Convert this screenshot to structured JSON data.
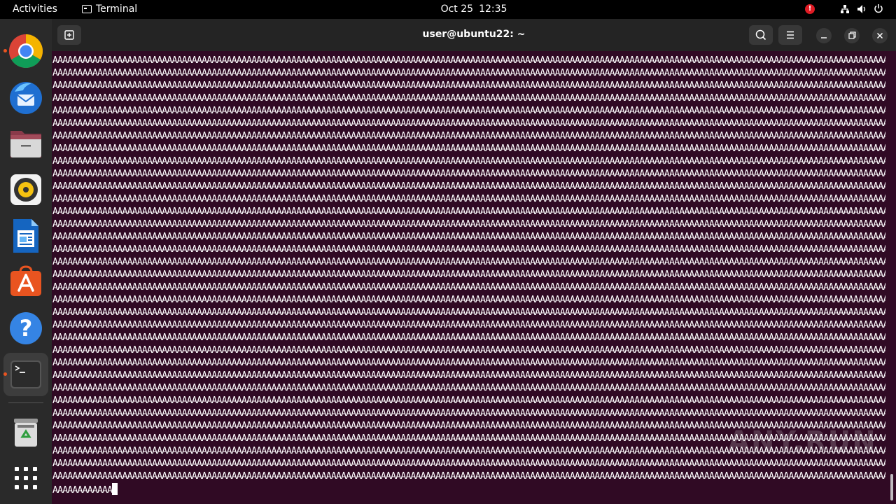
{
  "topbar": {
    "activities": "Activities",
    "app_name": "Terminal",
    "date": "Oct 25",
    "time": "12:35"
  },
  "dock": {
    "items": [
      "Google Chrome",
      "Thunderbird Mail",
      "Files",
      "Rhythmbox",
      "LibreOffice Writer",
      "Ubuntu Software",
      "Help",
      "Terminal",
      "Trash",
      "Show Applications"
    ]
  },
  "window": {
    "title": "user@ubuntu22: ~"
  },
  "terminal": {
    "line_text": "AAAAAAAAAAAAAAAAAAAAAAAAAAAAAAAAAAAAAAAAAAAAAAAAAAAAAAAAAAAAAAAAAAAAAAAAAAAAAAAAAAAAAAAAAAAAAAAAAAAAAAAAAAAAAAAAAAAAAAAAAAAAAAAAAAAAAAAAAAAAAAAAAAAAAAAAAAAAAAAAAAAAAAAAAA",
    "full_lines": 34,
    "last_line": "AAAAAAAAAAAA"
  },
  "watermark": "ANY.RUN",
  "colors": {
    "terminal_bg": "#300a24",
    "accent": "#e95420"
  }
}
